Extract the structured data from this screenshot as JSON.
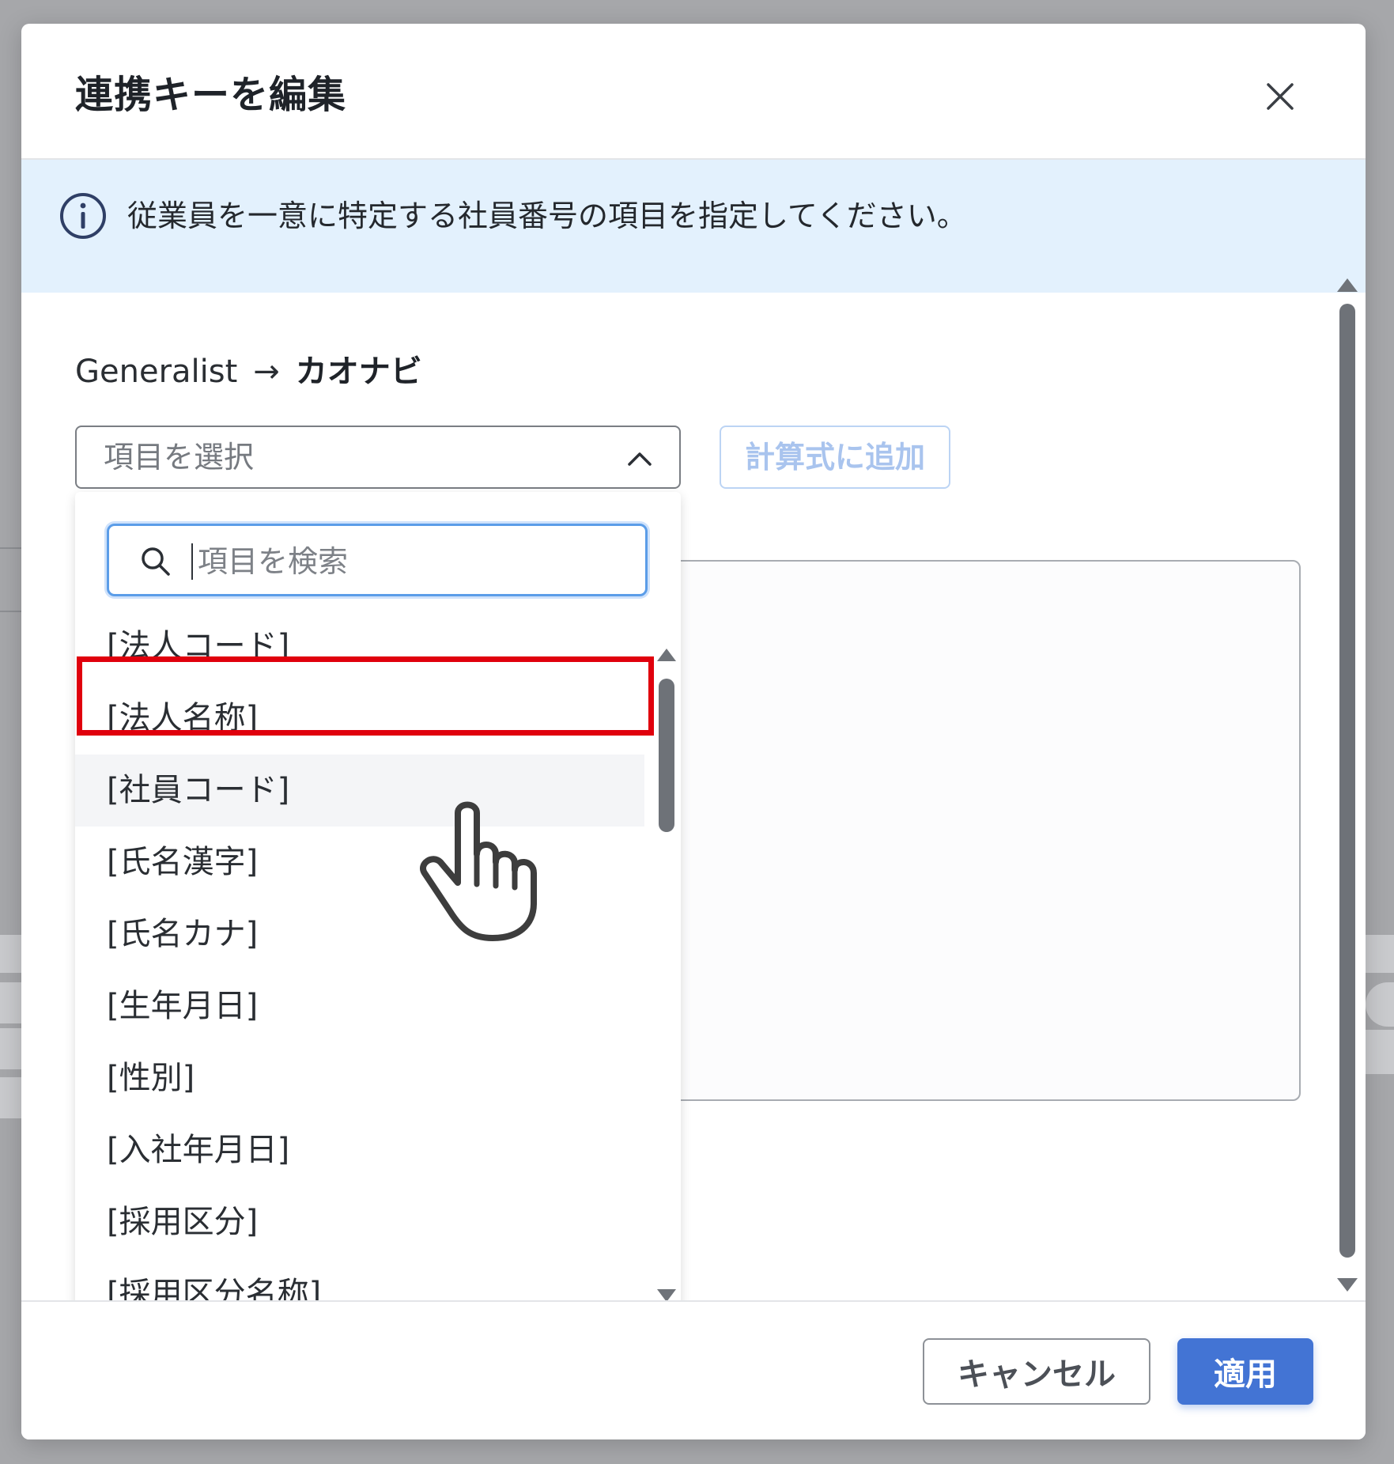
{
  "dialog": {
    "title": "連携キーを編集",
    "close_icon": "close-icon"
  },
  "info": {
    "icon": "info-icon",
    "message": "従業員を一意に特定する社員番号の項目を指定してください。"
  },
  "mapping": {
    "source": "Generalist",
    "arrow": "→",
    "target": "カオナビ"
  },
  "field_select": {
    "placeholder": "項目を選択",
    "icon": "chevron-up-icon"
  },
  "add_formula_button": "計算式に追加",
  "search": {
    "placeholder": "項目を検索",
    "value": "",
    "icon": "search-icon"
  },
  "options": [
    "[法人コード]",
    "[法人名称]",
    "[社員コード]",
    "[氏名漢字]",
    "[氏名カナ]",
    "[生年月日]",
    "[性別]",
    "[入社年月日]",
    "[採用区分]",
    "[採用区分名称]"
  ],
  "highlighted_option": "[社員コード]",
  "footer": {
    "cancel_label": "キャンセル",
    "apply_label": "適用"
  },
  "colors": {
    "primary": "#4374d4",
    "highlight": "#e0000d",
    "info_background": "#e3f1fd"
  }
}
